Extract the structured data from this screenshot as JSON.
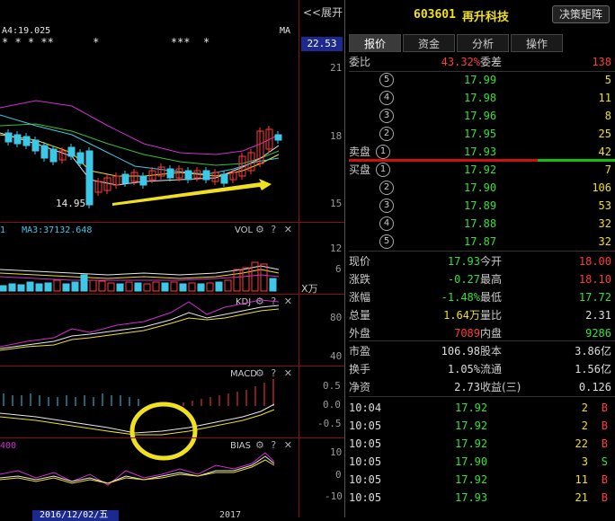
{
  "kline": {
    "ma_label": "A4:19.025",
    "ma_right": "MA",
    "expand_label": "<<展开",
    "stars": "* * * **      *           ***  *",
    "price_current": "22.53",
    "axis_ticks": [
      "21",
      "18",
      "15"
    ],
    "low_label": "14.95"
  },
  "vol": {
    "title": "VOL",
    "ma_label": "1   MA3:37132.648",
    "axis_ticks": [
      "12",
      "6",
      "X万"
    ]
  },
  "kdj": {
    "title": "KDJ",
    "axis_ticks": [
      "80",
      "40"
    ]
  },
  "macd": {
    "title": "MACD",
    "axis_ticks": [
      "0.5",
      "0.0",
      "-0.5"
    ]
  },
  "bias": {
    "title": "BIAS",
    "left_label": "400",
    "axis_ticks": [
      "10",
      "0",
      "-10"
    ]
  },
  "bottom": {
    "date_label": "2016/12/02/五",
    "year_label": "2017"
  },
  "header": {
    "code": "603601",
    "name": "再升科技",
    "matrix_button": "决策矩阵"
  },
  "tabs": [
    "报价",
    "资金",
    "分析",
    "操作"
  ],
  "ratio": {
    "label": "委比",
    "value": "43.32%",
    "diff_label": "委差",
    "diff": "138"
  },
  "sell": [
    {
      "level": "5",
      "price": "17.99",
      "vol": "5"
    },
    {
      "level": "4",
      "price": "17.98",
      "vol": "11"
    },
    {
      "level": "3",
      "price": "17.96",
      "vol": "8"
    },
    {
      "level": "2",
      "price": "17.95",
      "vol": "25"
    },
    {
      "level": "1",
      "price": "17.93",
      "vol": "42",
      "label": "卖盘"
    }
  ],
  "buy": [
    {
      "level": "1",
      "price": "17.92",
      "vol": "7",
      "label": "买盘"
    },
    {
      "level": "2",
      "price": "17.90",
      "vol": "106"
    },
    {
      "level": "3",
      "price": "17.89",
      "vol": "53"
    },
    {
      "level": "4",
      "price": "17.88",
      "vol": "32"
    },
    {
      "level": "5",
      "price": "17.87",
      "vol": "32"
    }
  ],
  "stats": [
    {
      "l1": "现价",
      "v1": "17.93",
      "l2": "今开",
      "v2": "18.00"
    },
    {
      "l1": "涨跌",
      "v1": "-0.27",
      "l2": "最高",
      "v2": "18.10"
    },
    {
      "l1": "涨幅",
      "v1": "-1.48%",
      "l2": "最低",
      "v2": "17.72"
    },
    {
      "l1": "总量",
      "v1": "1.64万",
      "l2": "量比",
      "v2": "2.31"
    },
    {
      "l1": "外盘",
      "v1": "7089",
      "l2": "内盘",
      "v2": "9286"
    }
  ],
  "stats2": [
    {
      "l1": "市盈",
      "v1": "106.98",
      "l2": "股本",
      "v2": "3.86亿"
    },
    {
      "l1": "换手",
      "v1": "1.05%",
      "l2": "流通",
      "v2": "1.56亿"
    },
    {
      "l1": "净资",
      "v1": "2.73",
      "l2": "收益(三)",
      "v2": "0.126"
    }
  ],
  "ticks": [
    {
      "time": "10:04",
      "price": "17.92",
      "vol": "2",
      "side": "B"
    },
    {
      "time": "10:05",
      "price": "17.92",
      "vol": "2",
      "side": "B"
    },
    {
      "time": "10:05",
      "price": "17.92",
      "vol": "22",
      "side": "B"
    },
    {
      "time": "10:05",
      "price": "17.90",
      "vol": "3",
      "side": "S"
    },
    {
      "time": "10:05",
      "price": "17.92",
      "vol": "11",
      "side": "B"
    },
    {
      "time": "10:05",
      "price": "17.93",
      "vol": "21",
      "side": "B"
    }
  ],
  "colors": {
    "up": "#ff3b3b",
    "down": "#3ec8e8",
    "accent": "#f0e020",
    "grid": "#8b0f0f"
  }
}
